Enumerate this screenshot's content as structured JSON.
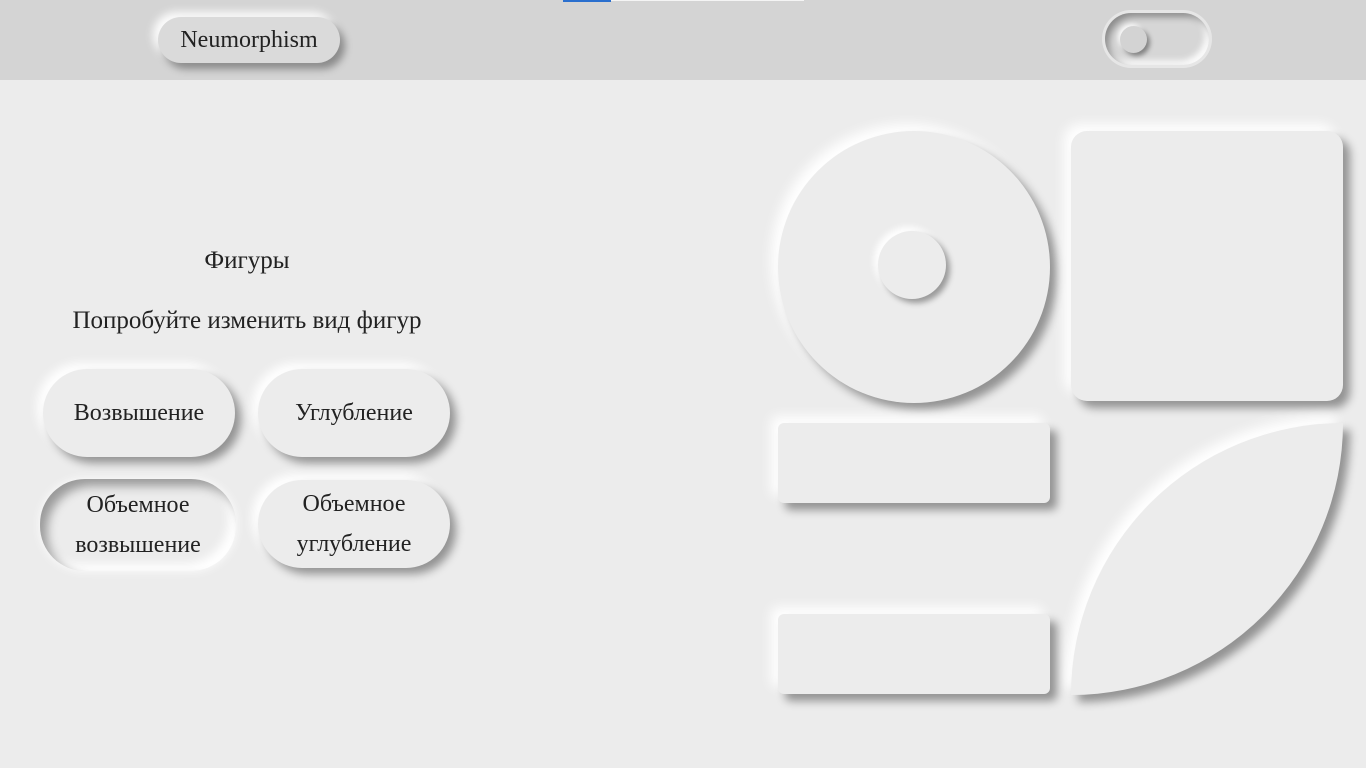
{
  "header": {
    "logo_text": "Neumorphism",
    "theme_toggle": "off"
  },
  "main": {
    "title": "Фигуры",
    "subtitle": "Попробуйте изменить вид фигур",
    "buttons": [
      {
        "label_lines": [
          "Возвышение"
        ]
      },
      {
        "label_lines": [
          "Углубление"
        ]
      },
      {
        "label_lines": [
          "Объемное",
          "возвышение"
        ]
      },
      {
        "label_lines": [
          "Объемное",
          "углубление"
        ]
      }
    ]
  },
  "shapes": [
    "circle",
    "square",
    "rectangle",
    "leaf",
    "rectangle"
  ]
}
